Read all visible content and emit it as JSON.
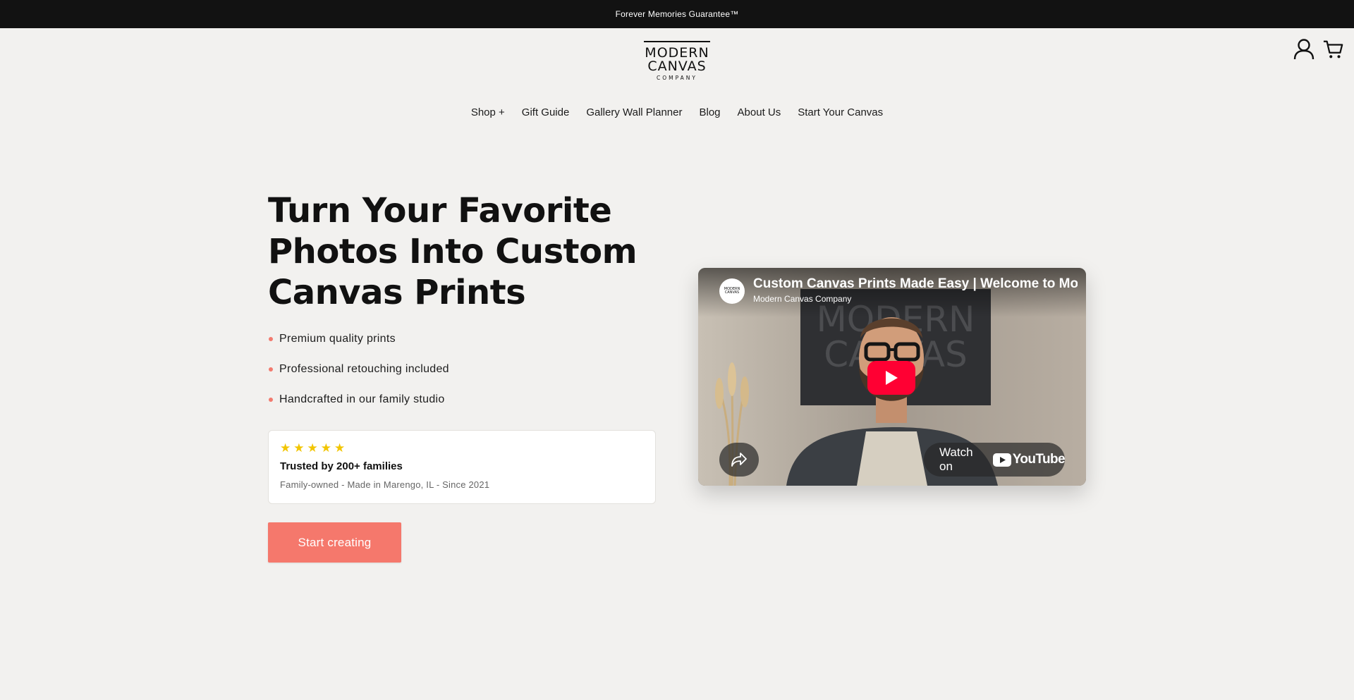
{
  "announcement": "Forever Memories Guarantee™",
  "logo": {
    "line1": "MODERN",
    "line2": "CANVAS",
    "line3": "COMPANY"
  },
  "header_icons": [
    "account-icon",
    "cart-icon"
  ],
  "nav": {
    "items": [
      "Shop +",
      "Gift Guide",
      "Gallery Wall Planner",
      "Blog",
      "About Us",
      "Start Your Canvas"
    ]
  },
  "hero": {
    "title": "Turn Your Favorite Photos Into Custom Canvas Prints",
    "features": [
      "Premium quality prints",
      "Professional retouching included",
      "Handcrafted in our family studio"
    ]
  },
  "trust": {
    "stars": "★★★★★",
    "rating": 5,
    "title": "Trusted by 200+ families",
    "subtitle": "Family-owned - Made in Marengo, IL - Since 2021"
  },
  "cta": {
    "label": "Start creating"
  },
  "video": {
    "title": "Custom Canvas Prints Made Easy | Welcome to Modern Canvas Company",
    "channel": "Modern Canvas Company",
    "avatar_text": "MODERN CANVAS",
    "watch_label": "Watch on",
    "youtube_word": "YouTube",
    "background_sign": {
      "line1": "MODERN",
      "line2": "CANVAS"
    }
  },
  "colors": {
    "accent": "#f5786c",
    "bullet": "#f27a6e",
    "star": "#f2c500",
    "announcement_bg": "#121212",
    "page_bg": "#f2f1ef",
    "youtube_red": "#ff0033"
  }
}
